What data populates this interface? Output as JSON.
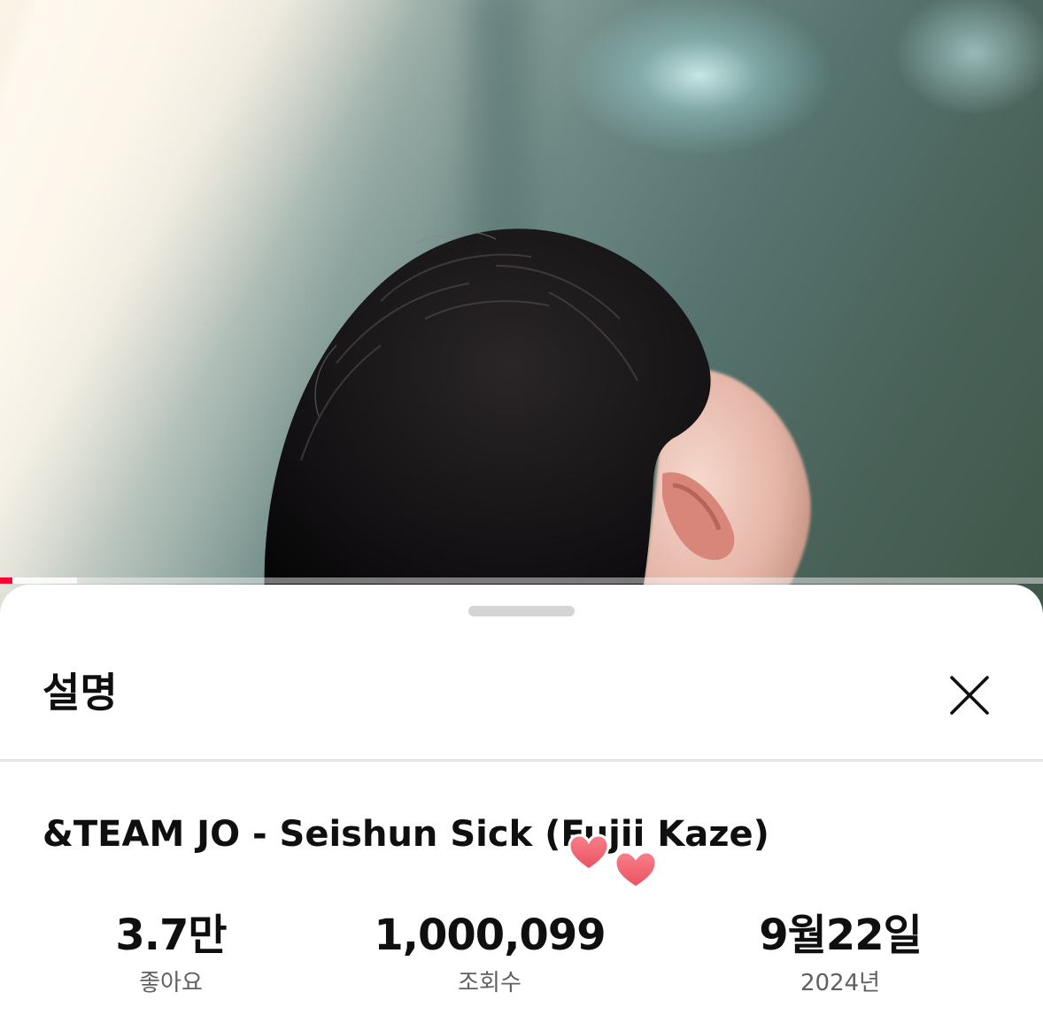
{
  "video": {
    "progress_played": 0.012,
    "progress_buffered": 0.074,
    "accent_color": "#ff0033"
  },
  "sheet": {
    "title": "설명",
    "close_icon": "close-icon"
  },
  "description": {
    "video_title": "&TEAM JO - Seishun Sick (Fujii Kaze)",
    "stats": {
      "likes_value": "3.7만",
      "likes_label": "좋아요",
      "views_value": "1,000,099",
      "views_label": "조회수",
      "date_value": "9월22일",
      "date_label": "2024년"
    },
    "sticker": "hearts-sticker",
    "sticker_color": "#f0606e"
  }
}
